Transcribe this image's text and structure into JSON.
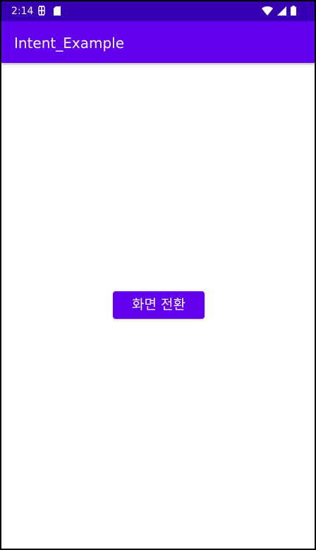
{
  "status_bar": {
    "time": "2:14",
    "background_color": "#3700B3",
    "left_icons": [
      "sim-toolkit-icon",
      "sd-card-icon"
    ],
    "right_icons": [
      "wifi-icon",
      "cellular-signal-icon",
      "battery-icon"
    ]
  },
  "app_bar": {
    "title": "Intent_Example",
    "background_color": "#6200EE"
  },
  "main": {
    "switch_screen_button": "화면 전환",
    "button_color": "#6200EE"
  }
}
